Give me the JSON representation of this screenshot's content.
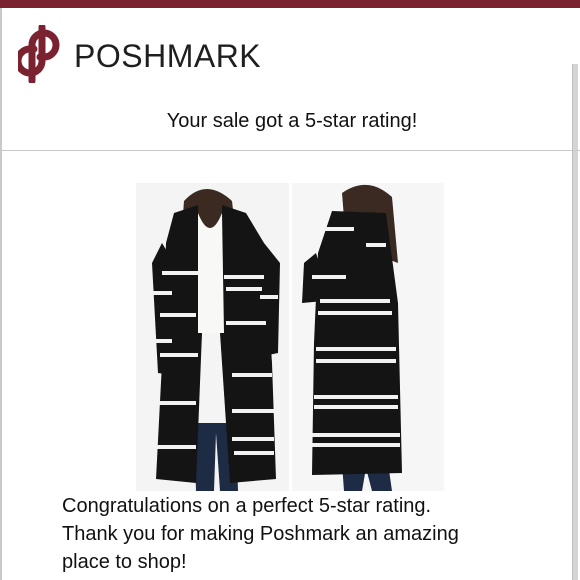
{
  "brand": {
    "name": "POSHMARK",
    "accent_color": "#7b2230",
    "logo_icon": "poshmark-logo-icon"
  },
  "email": {
    "headline": "Your sale got a 5-star rating!",
    "message_lines": [
      "Congratulations on a perfect 5-star rating.",
      "Thank you for making Poshmark an amazing",
      "place to shop!"
    ]
  },
  "product_image": {
    "icon": "striped-cardigan-photo",
    "colors": {
      "sweater": "#141414",
      "stripe": "#f2f2f2",
      "jeans": "#1e2b45",
      "tee": "#f8f8f6"
    }
  }
}
